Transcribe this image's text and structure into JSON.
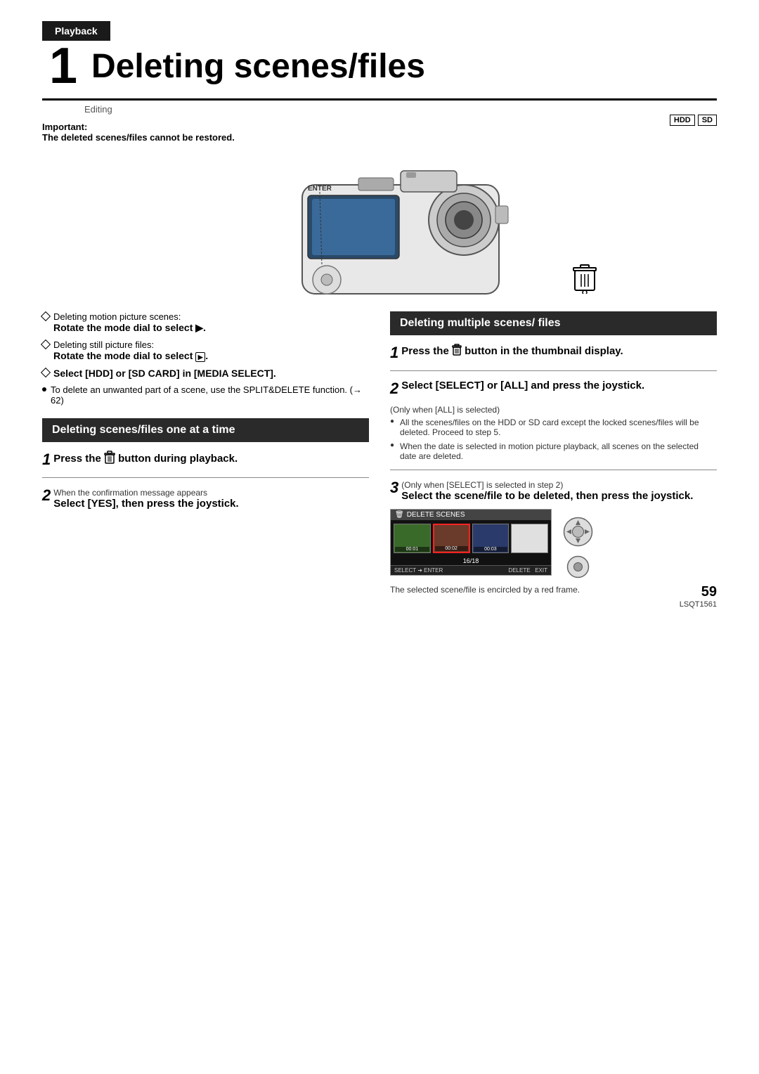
{
  "header": {
    "playback_label": "Playback",
    "editing_label": "Editing",
    "chapter_number": "1",
    "page_title": "Deleting scenes/files"
  },
  "media_badges": [
    "HDD",
    "SD"
  ],
  "important": {
    "label": "Important:",
    "text": "The deleted scenes/files cannot be restored."
  },
  "camera_label": "ENTER",
  "left_instructions": {
    "item1_label": "Deleting motion picture scenes:",
    "item1_bold": "Rotate the mode dial to select ▶.",
    "item2_label": "Deleting still picture files:",
    "item2_bold": "Rotate the mode dial to select 🎞.",
    "item3_bold": "Select [HDD] or [SD CARD] in [MEDIA SELECT].",
    "note1": "To delete an unwanted part of a scene, use the SPLIT&DELETE function. (→ 62)"
  },
  "section1": {
    "title": "Deleting scenes/files one at a time",
    "step1_num": "1",
    "step1_main": "Press the 🗑 button during playback.",
    "step2_num": "2",
    "step2_sub": "When the confirmation message appears",
    "step2_bold": "Select [YES], then press the joystick."
  },
  "section2": {
    "title": "Deleting multiple scenes/ files",
    "step1_num": "1",
    "step1_main": "Press the 🗑 button in the thumbnail display.",
    "step2_num": "2",
    "step2_main": "Select [SELECT] or [ALL] and press the joystick.",
    "step2_sub_label": "(Only when [ALL] is selected)",
    "step2_note1": "All the scenes/files on the HDD or SD card except the locked scenes/files will be deleted. Proceed to step 5.",
    "step2_note2": "When the date is selected in motion picture playback, all scenes on the selected date are deleted.",
    "step3_num": "3",
    "step3_sub": "(Only when [SELECT] is selected in step 2)",
    "step3_bold": "Select the scene/file to be deleted, then press the joystick.",
    "caption": "The selected scene/file is encircled by a red frame."
  },
  "delete_screen": {
    "header": "DELETE SCENES",
    "counter": "16/18",
    "footer_left": "SELECT ➜ ENTER",
    "footer_right_delete": "DELETE",
    "footer_right_exit": "EXIT"
  },
  "page": {
    "number": "59",
    "code": "LSQT1561"
  }
}
